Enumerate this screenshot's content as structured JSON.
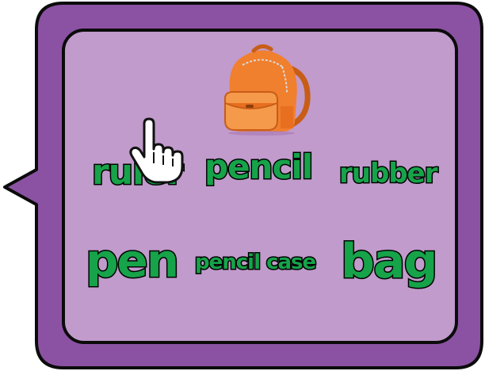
{
  "colors": {
    "frame_outer": "#8b52a3",
    "panel": "#c09bcb",
    "outline": "#0b0b0b",
    "word_fill": "#16a34a",
    "backpack": "#f07f2e"
  },
  "icons": {
    "backpack": "backpack-icon",
    "cursor": "hand-pointer-icon"
  },
  "words": {
    "ruler": "ruler",
    "pencil": "pencil",
    "rubber": "rubber",
    "pen": "pen",
    "pencil_case": "pencil case",
    "bag": "bag"
  }
}
